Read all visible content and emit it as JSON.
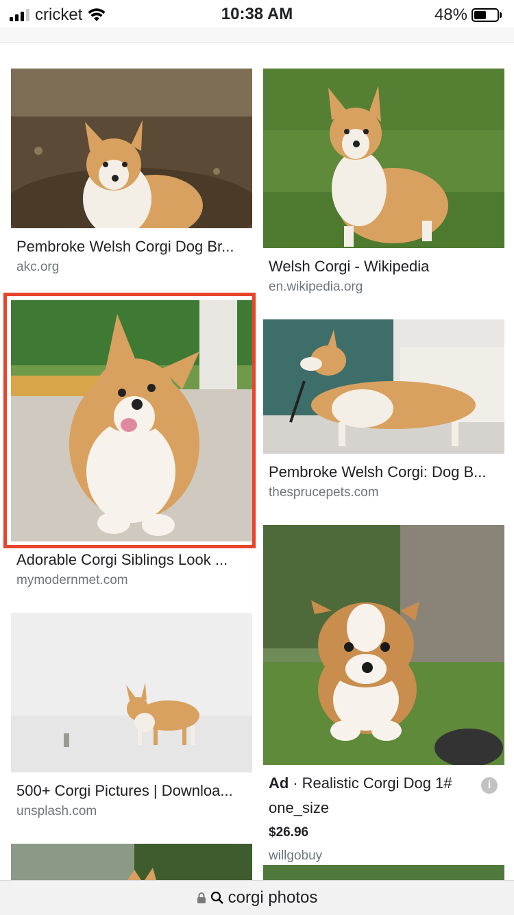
{
  "status": {
    "carrier": "cricket",
    "time": "10:38 AM",
    "battery": "48%",
    "battery_level": 0.48,
    "icons": [
      "signal-icon",
      "wifi-icon",
      "battery-icon"
    ]
  },
  "results": [
    {
      "title": "Pembroke Welsh Corgi Dog Br...",
      "source": "akc.org",
      "image": "corgi standing on dirt"
    },
    {
      "title": "Welsh Corgi - Wikipedia",
      "source": "en.wikipedia.org",
      "image": "corgi on grass"
    },
    {
      "title": "Adorable Corgi Siblings Look ...",
      "source": "mymodernmet.com",
      "image": "corgi puppy sitting",
      "selected": true
    },
    {
      "title": "Pembroke Welsh Corgi: Dog B...",
      "source": "thesprucepets.com",
      "image": "corgi by green chair"
    },
    {
      "title": "500+ Corgi Pictures | Downloa...",
      "source": "unsplash.com",
      "image": "corgi on white background"
    }
  ],
  "ad": {
    "badge": "Ad",
    "separator": "·",
    "title": "Realistic Corgi Dog 1#",
    "subtitle": "one_size",
    "price": "$26.96",
    "seller": "willgobuy",
    "info_icon": "i"
  },
  "url_bar": {
    "text": "corgi photos",
    "icons": [
      "lock-icon",
      "search-icon"
    ]
  },
  "colors": {
    "highlight": "#e8452c",
    "grass": "#5f8a3a",
    "corgi_fur": "#d9a15f"
  }
}
